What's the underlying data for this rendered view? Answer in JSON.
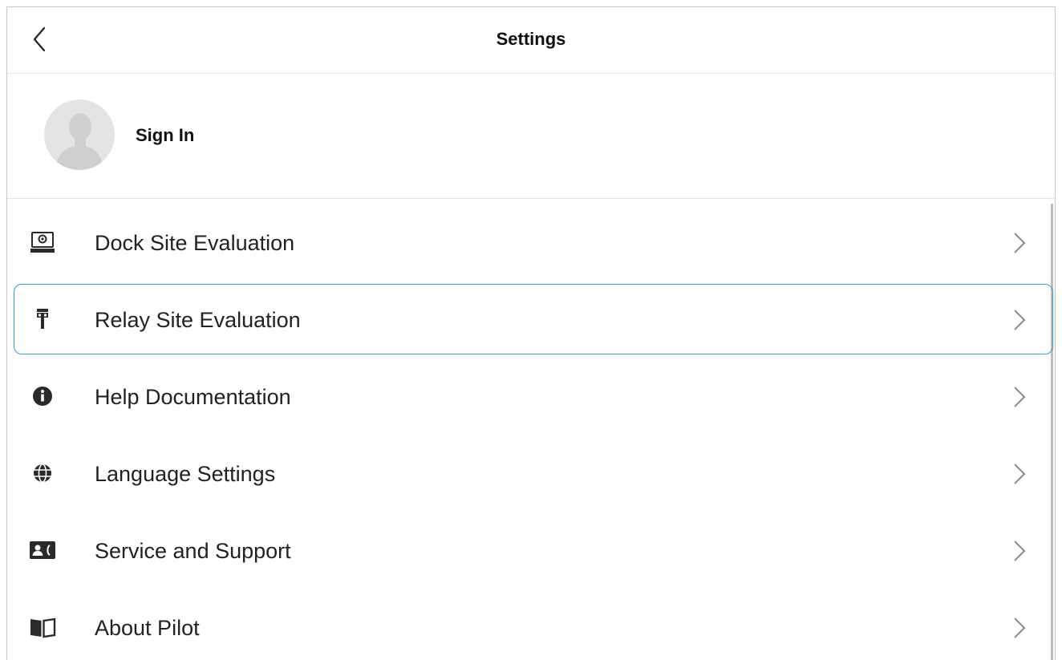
{
  "header": {
    "title": "Settings",
    "back_icon": "chevron-left-icon"
  },
  "account": {
    "label": "Sign In",
    "avatar_icon": "user-silhouette-icon"
  },
  "menu": {
    "selected_index": 1,
    "accent_color": "#29a3e0",
    "items": [
      {
        "label": "Dock Site Evaluation",
        "icon": "dock-camera-icon"
      },
      {
        "label": "Relay Site Evaluation",
        "icon": "relay-antenna-icon"
      },
      {
        "label": "Help Documentation",
        "icon": "info-icon"
      },
      {
        "label": "Language Settings",
        "icon": "globe-icon"
      },
      {
        "label": "Service and Support",
        "icon": "contact-card-icon"
      },
      {
        "label": "About Pilot",
        "icon": "book-icon"
      }
    ]
  }
}
